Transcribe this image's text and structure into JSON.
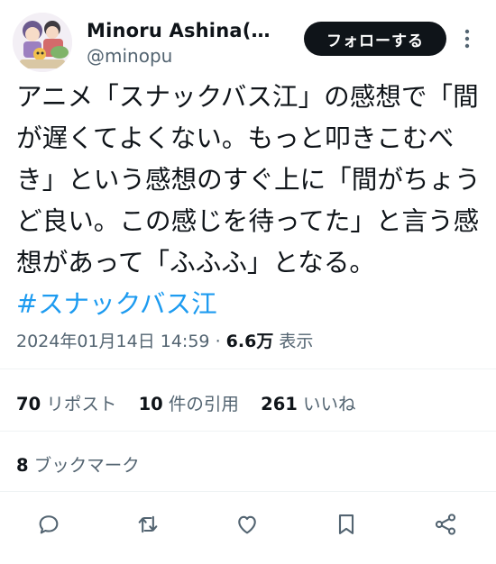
{
  "author": {
    "display_name": "Minoru Ashina(芦…",
    "handle": "@minopu",
    "follow_label": "フォローする"
  },
  "tweet": {
    "lines": [
      "アニメ「スナックバス江」の感想で「間",
      "が遅くてよくない。もっと叩きこむべ",
      "き」という感想のすぐ上に「間がちょう",
      "ど良い。この感じを待ってた」と言う感",
      "想があって「ふふふ」となる。"
    ],
    "hashtag": "#スナックバス江"
  },
  "meta": {
    "timestamp": "2024年01月14日 14:59",
    "separator": "·",
    "views_count": "6.6万",
    "views_label": "表示"
  },
  "stats": {
    "reposts_count": "70",
    "reposts_label": "リポスト",
    "quotes_count": "10",
    "quotes_label": "件の引用",
    "likes_count": "261",
    "likes_label": "いいね",
    "bookmarks_count": "8",
    "bookmarks_label": "ブックマーク"
  },
  "actions": {
    "icons": [
      "reply-icon",
      "repost-icon",
      "like-icon",
      "bookmark-icon",
      "share-icon"
    ]
  },
  "colors": {
    "text": "#0f1419",
    "secondary": "#536471",
    "link": "#1d9bf0",
    "divider": "#eff3f4",
    "button_bg": "#0f1419"
  }
}
